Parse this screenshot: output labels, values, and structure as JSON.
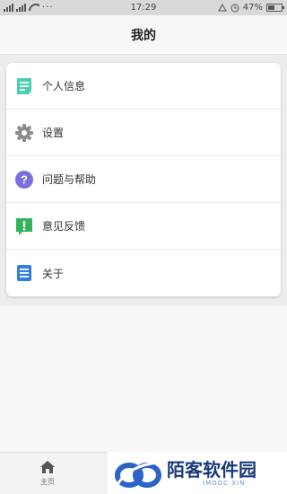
{
  "status_bar": {
    "time": "17:29",
    "battery_percent": "47%",
    "battery_level": 0.47,
    "icons": [
      "signal-icon",
      "wifi-icon",
      "more-dots-icon",
      "alarm-icon",
      "clock-icon",
      "battery-icon"
    ]
  },
  "header": {
    "title": "我的"
  },
  "menu": {
    "items": [
      {
        "label": "个人信息",
        "icon": "profile-card-icon",
        "color": "#4ccfae"
      },
      {
        "label": "设置",
        "icon": "gear-icon",
        "color": "#8c8c8c"
      },
      {
        "label": "问题与帮助",
        "icon": "question-icon",
        "color": "#7b6fe0"
      },
      {
        "label": "意见反馈",
        "icon": "feedback-icon",
        "color": "#34b35a"
      },
      {
        "label": "关于",
        "icon": "document-icon",
        "color": "#2f7fe0"
      }
    ]
  },
  "tabbar": {
    "home_label": "主页",
    "home_icon": "home-icon"
  },
  "watermark": {
    "title": "陌客软件园",
    "subtitle": "IMOOC XIN"
  }
}
